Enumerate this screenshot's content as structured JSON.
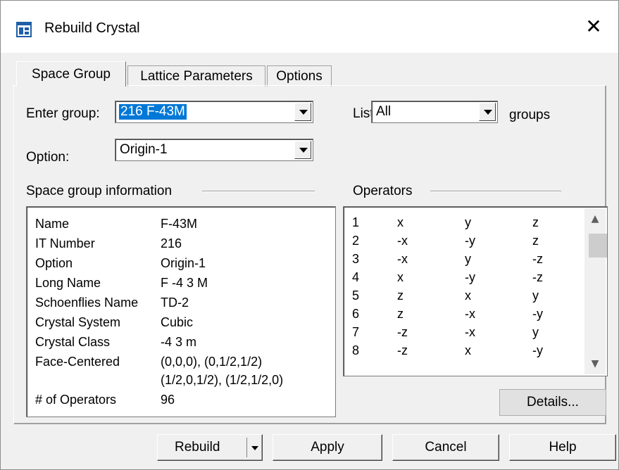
{
  "window": {
    "title": "Rebuild Crystal"
  },
  "tabs": [
    {
      "label": "Space Group",
      "active": true
    },
    {
      "label": "Lattice Parameters",
      "active": false
    },
    {
      "label": "Options",
      "active": false
    }
  ],
  "enter_group": {
    "label": "Enter group:",
    "value": "216  F-43M"
  },
  "list": {
    "label": "List",
    "value": "All",
    "suffix": "groups"
  },
  "option": {
    "label": "Option:",
    "value": "Origin-1"
  },
  "info": {
    "heading": "Space group information",
    "rows": [
      {
        "key": "Name",
        "value": "F-43M"
      },
      {
        "key": "IT Number",
        "value": "216"
      },
      {
        "key": "Option",
        "value": "Origin-1"
      },
      {
        "key": "Long Name",
        "value": "F -4 3 M"
      },
      {
        "key": "Schoenflies Name",
        "value": "TD-2"
      },
      {
        "key": "Crystal System",
        "value": "Cubic"
      },
      {
        "key": "Crystal Class",
        "value": "-4 3 m"
      },
      {
        "key": "Face-Centered",
        "value": "(0,0,0), (0,1/2,1/2)"
      },
      {
        "key": "",
        "value": "(1/2,0,1/2), (1/2,1/2,0)"
      },
      {
        "key": "# of Operators",
        "value": "96"
      }
    ]
  },
  "operators": {
    "heading": "Operators",
    "rows": [
      {
        "n": "1",
        "x": "x",
        "y": "y",
        "z": "z"
      },
      {
        "n": "2",
        "x": "-x",
        "y": "-y",
        "z": "z"
      },
      {
        "n": "3",
        "x": "-x",
        "y": "y",
        "z": "-z"
      },
      {
        "n": "4",
        "x": "x",
        "y": "-y",
        "z": "-z"
      },
      {
        "n": "5",
        "x": "z",
        "y": "x",
        "z": "y"
      },
      {
        "n": "6",
        "x": "z",
        "y": "-x",
        "z": "-y"
      },
      {
        "n": "7",
        "x": "-z",
        "y": "-x",
        "z": "y"
      },
      {
        "n": "8",
        "x": "-z",
        "y": "x",
        "z": "-y"
      }
    ]
  },
  "buttons": {
    "details": "Details...",
    "rebuild": "Rebuild",
    "apply": "Apply",
    "cancel": "Cancel",
    "help": "Help"
  },
  "icons": {
    "app": "window-icon",
    "close": "close-icon",
    "scroll_up": "chevron-up-icon",
    "scroll_down": "chevron-down-icon",
    "dropdown": "triangle-down-icon"
  },
  "colors": {
    "selection": "#0078d7",
    "app_icon": "#1e5fa8"
  }
}
